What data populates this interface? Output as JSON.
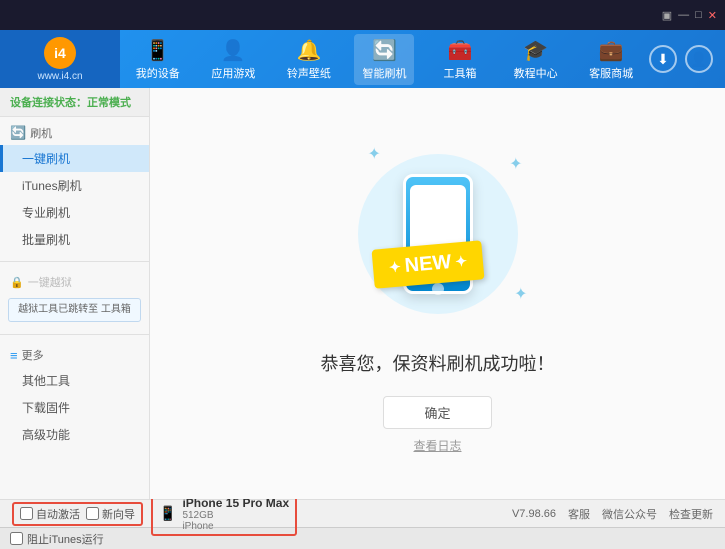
{
  "topbar": {
    "icons": [
      "▣",
      "—",
      "✕"
    ]
  },
  "header": {
    "logo_text": "www.i4.cn",
    "logo_abbr": "i4",
    "nav_items": [
      {
        "label": "我的设备",
        "icon": "📱",
        "active": false
      },
      {
        "label": "应用游戏",
        "icon": "👤",
        "active": false
      },
      {
        "label": "铃声壁纸",
        "icon": "🔔",
        "active": false
      },
      {
        "label": "智能刷机",
        "icon": "🔄",
        "active": true
      },
      {
        "label": "工具箱",
        "icon": "🧰",
        "active": false
      },
      {
        "label": "教程中心",
        "icon": "🎓",
        "active": false
      },
      {
        "label": "客服商城",
        "icon": "💼",
        "active": false
      }
    ]
  },
  "sidebar": {
    "status_label": "设备连接状态：",
    "status_value": "正常模式",
    "sections": [
      {
        "title": "刷机",
        "icon": "🔄",
        "items": [
          {
            "label": "一键刷机",
            "active": true
          },
          {
            "label": "iTunes刷机",
            "active": false
          },
          {
            "label": "专业刷机",
            "active": false
          },
          {
            "label": "批量刷机",
            "active": false
          }
        ]
      },
      {
        "title": "一键越狱",
        "disabled": true,
        "note": "越狱工具已跳转至\n工具箱"
      },
      {
        "title": "更多",
        "icon": "≡",
        "items": [
          {
            "label": "其他工具",
            "active": false
          },
          {
            "label": "下载固件",
            "active": false
          },
          {
            "label": "高级功能",
            "active": false
          }
        ]
      }
    ]
  },
  "content": {
    "success_title": "恭喜您，保资料刷机成功啦！",
    "btn_confirm": "确定",
    "btn_log": "查看日志",
    "new_text": "NEW"
  },
  "bottom": {
    "checkbox_auto": "自动激活",
    "checkbox_guide": "新向导",
    "device_name": "iPhone 15 Pro Max",
    "device_storage": "512GB",
    "device_type": "iPhone",
    "version": "V7.98.66",
    "links": [
      "客服",
      "微信公众号",
      "检查更新"
    ]
  },
  "itunes_bar": {
    "checkbox_label": "阻止iTunes运行"
  }
}
